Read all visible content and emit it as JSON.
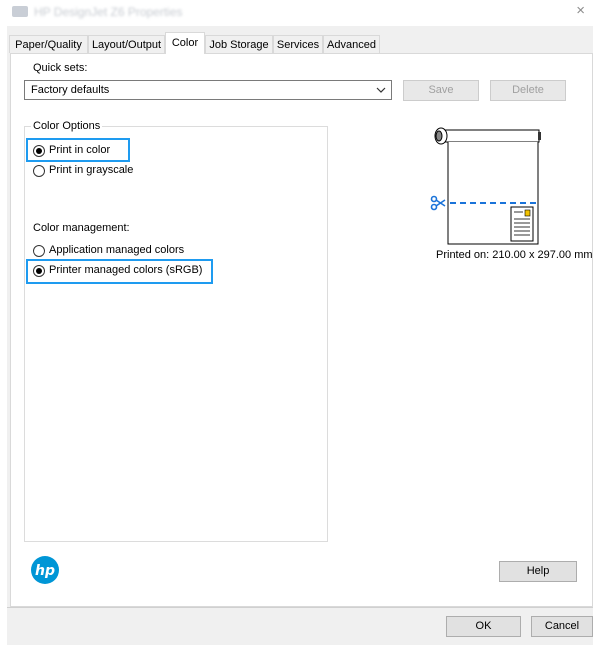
{
  "window": {
    "title": "HP DesignJet Z6 Properties",
    "close_glyph": "×"
  },
  "tabs": [
    {
      "label": "Paper/Quality"
    },
    {
      "label": "Layout/Output"
    },
    {
      "label": "Color"
    },
    {
      "label": "Job Storage"
    },
    {
      "label": "Services"
    },
    {
      "label": "Advanced"
    }
  ],
  "active_tab": "Color",
  "quick_sets": {
    "label": "Quick sets:",
    "selected": "Factory defaults",
    "save_label": "Save",
    "delete_label": "Delete"
  },
  "color_options": {
    "group_title": "Color Options",
    "print_in_color": "Print in color",
    "print_in_grayscale": "Print in grayscale",
    "color_management_label": "Color management:",
    "application_managed": "Application managed colors",
    "printer_managed": "Printer managed colors (sRGB)",
    "selected_color_mode": "Print in color",
    "selected_management": "Printer managed colors (sRGB)"
  },
  "preview": {
    "caption": "Printed on: 210.00 x 297.00 mm"
  },
  "footer": {
    "help_label": "Help",
    "ok_label": "OK",
    "cancel_label": "Cancel"
  },
  "colors": {
    "highlight": "#1e9bf0",
    "hp_logo": "#0096d6",
    "cut_line": "#1a73d9"
  }
}
